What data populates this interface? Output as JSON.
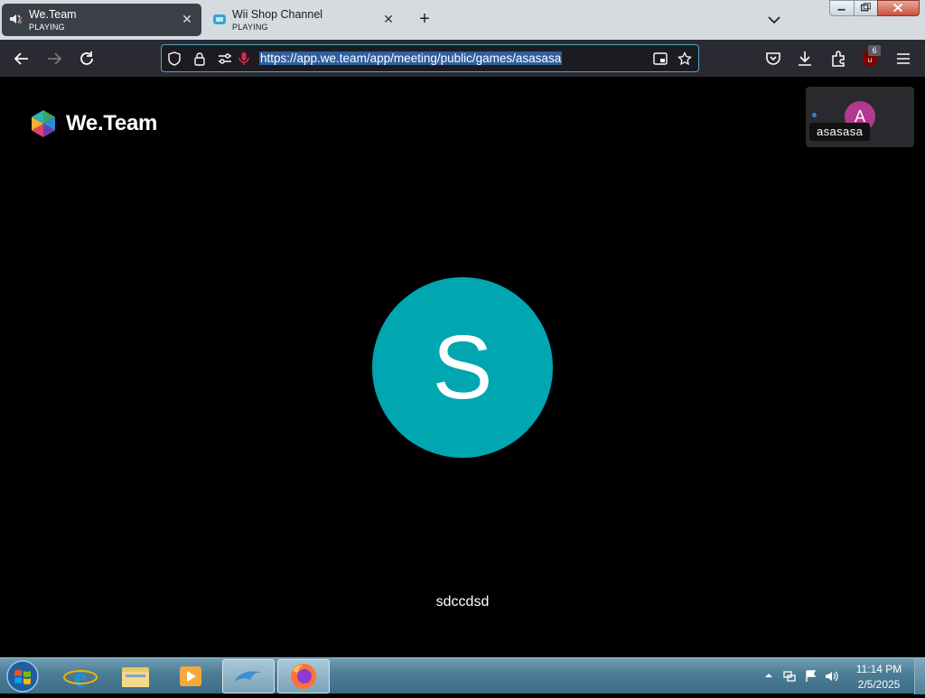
{
  "browser": {
    "tabs": [
      {
        "title": "We.Team",
        "status": "PLAYING",
        "icon": "weteam-favicon"
      },
      {
        "title": "Wii Shop Channel",
        "status": "PLAYING",
        "icon": "wii-favicon"
      }
    ],
    "url": "https://app.we.team/app/meeting/public/games/asasasa",
    "extension_badge": "6"
  },
  "page": {
    "logo_text": "We.Team",
    "participant_tile": {
      "initial": "A",
      "name": "asasasa",
      "avatar_color": "#b03a8f"
    },
    "main_participant": {
      "initial": "S",
      "name": "sdccdsd",
      "avatar_color": "#00a6b0"
    }
  },
  "taskbar": {
    "time": "11:14 PM",
    "date": "2/5/2025"
  }
}
